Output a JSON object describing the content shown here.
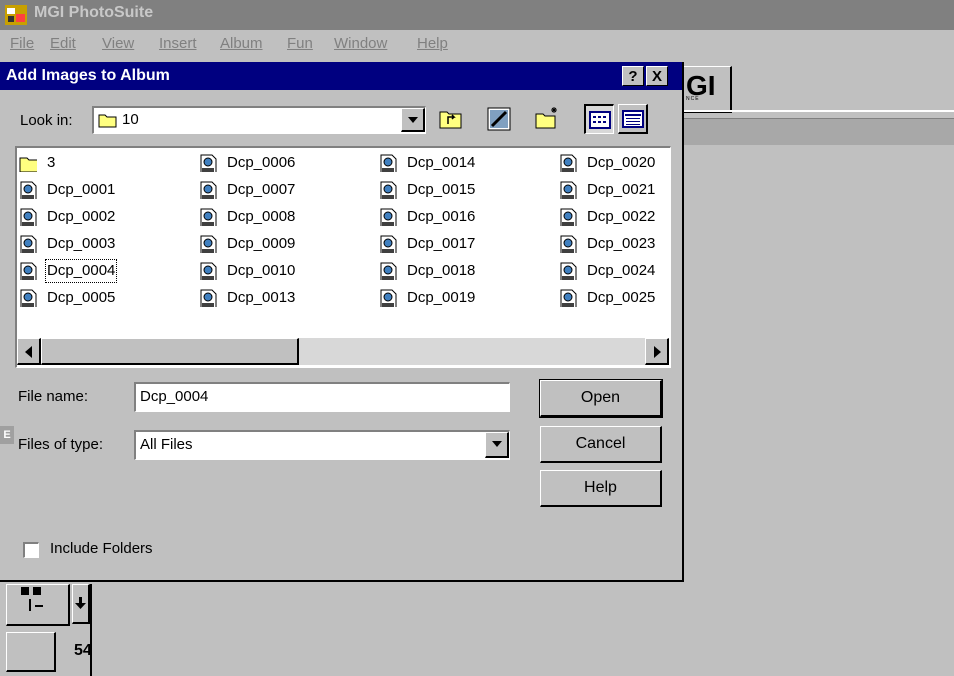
{
  "app": {
    "title": "MGI PhotoSuite",
    "logo_text": "GI",
    "logo_subtext": "NCE",
    "page_number": "54",
    "edge_letter": "E"
  },
  "menu": [
    "File",
    "Edit",
    "View",
    "Insert",
    "Album",
    "Fun",
    "Window",
    "Help"
  ],
  "dialog": {
    "title": "Add Images to Album",
    "help_btn": "?",
    "close_btn": "X",
    "look_in_label": "Look in:",
    "look_in_value": "10",
    "files": [
      [
        "3",
        "Dcp_0001",
        "Dcp_0002",
        "Dcp_0003",
        "Dcp_0004",
        "Dcp_0005"
      ],
      [
        "Dcp_0006",
        "Dcp_0007",
        "Dcp_0008",
        "Dcp_0009",
        "Dcp_0010",
        "Dcp_0013"
      ],
      [
        "Dcp_0014",
        "Dcp_0015",
        "Dcp_0016",
        "Dcp_0017",
        "Dcp_0018",
        "Dcp_0019"
      ],
      [
        "Dcp_0020",
        "Dcp_0021",
        "Dcp_0022",
        "Dcp_0023",
        "Dcp_0024",
        "Dcp_0025"
      ]
    ],
    "selected_file": "Dcp_0004",
    "file_name_label": "File name:",
    "file_name_value": "Dcp_0004",
    "file_type_label": "Files of type:",
    "file_type_value": "All Files",
    "open_label": "Open",
    "cancel_label": "Cancel",
    "help_label": "Help",
    "include_folders_label": "Include Folders",
    "include_folders_checked": false
  },
  "colors": {
    "title_active": "#000080",
    "face": "#c0c0c0"
  },
  "icons": {
    "folder": "folder-icon",
    "image_file": "image-file-icon",
    "up_folder": "up-one-level-icon",
    "preview": "preview-icon",
    "new_folder": "new-folder-icon",
    "list_view": "list-view-icon",
    "details_view": "details-view-icon"
  }
}
